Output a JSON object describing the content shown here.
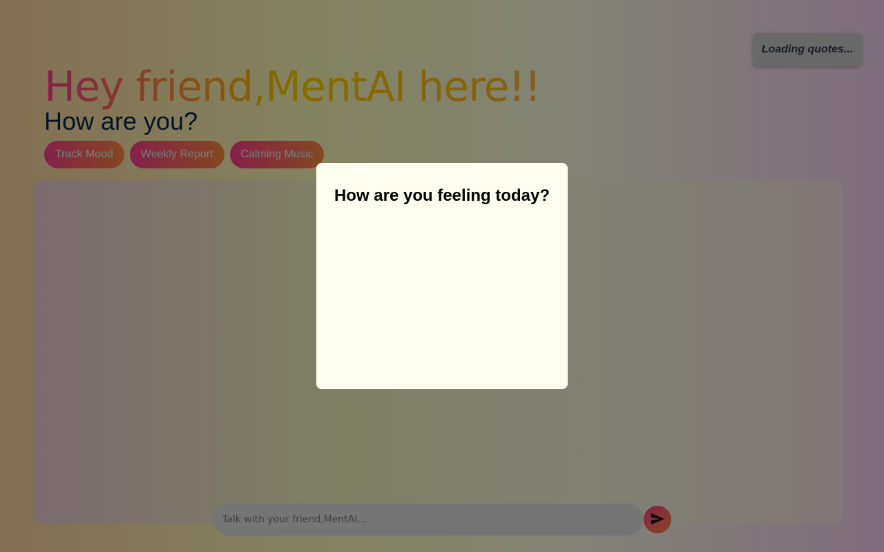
{
  "header": {
    "greeting": "Hey friend,MentAI here!!",
    "subgreeting": "How are you?"
  },
  "actions": [
    {
      "label": "Track Mood"
    },
    {
      "label": "Weekly Report"
    },
    {
      "label": "Calming Music"
    }
  ],
  "quote": {
    "text": "Loading quotes..."
  },
  "chat": {
    "input_placeholder": "Talk with your friend,MentAI...",
    "input_value": "",
    "send_icon": "send-icon"
  },
  "modal": {
    "title": "How are you feeling today?"
  },
  "colors": {
    "accent_pink": "#ff3d8f",
    "accent_orange": "#ff8b3d",
    "accent_yellow": "#ffd000",
    "heading_navy": "#06284d",
    "modal_bg": "#fffff0"
  }
}
